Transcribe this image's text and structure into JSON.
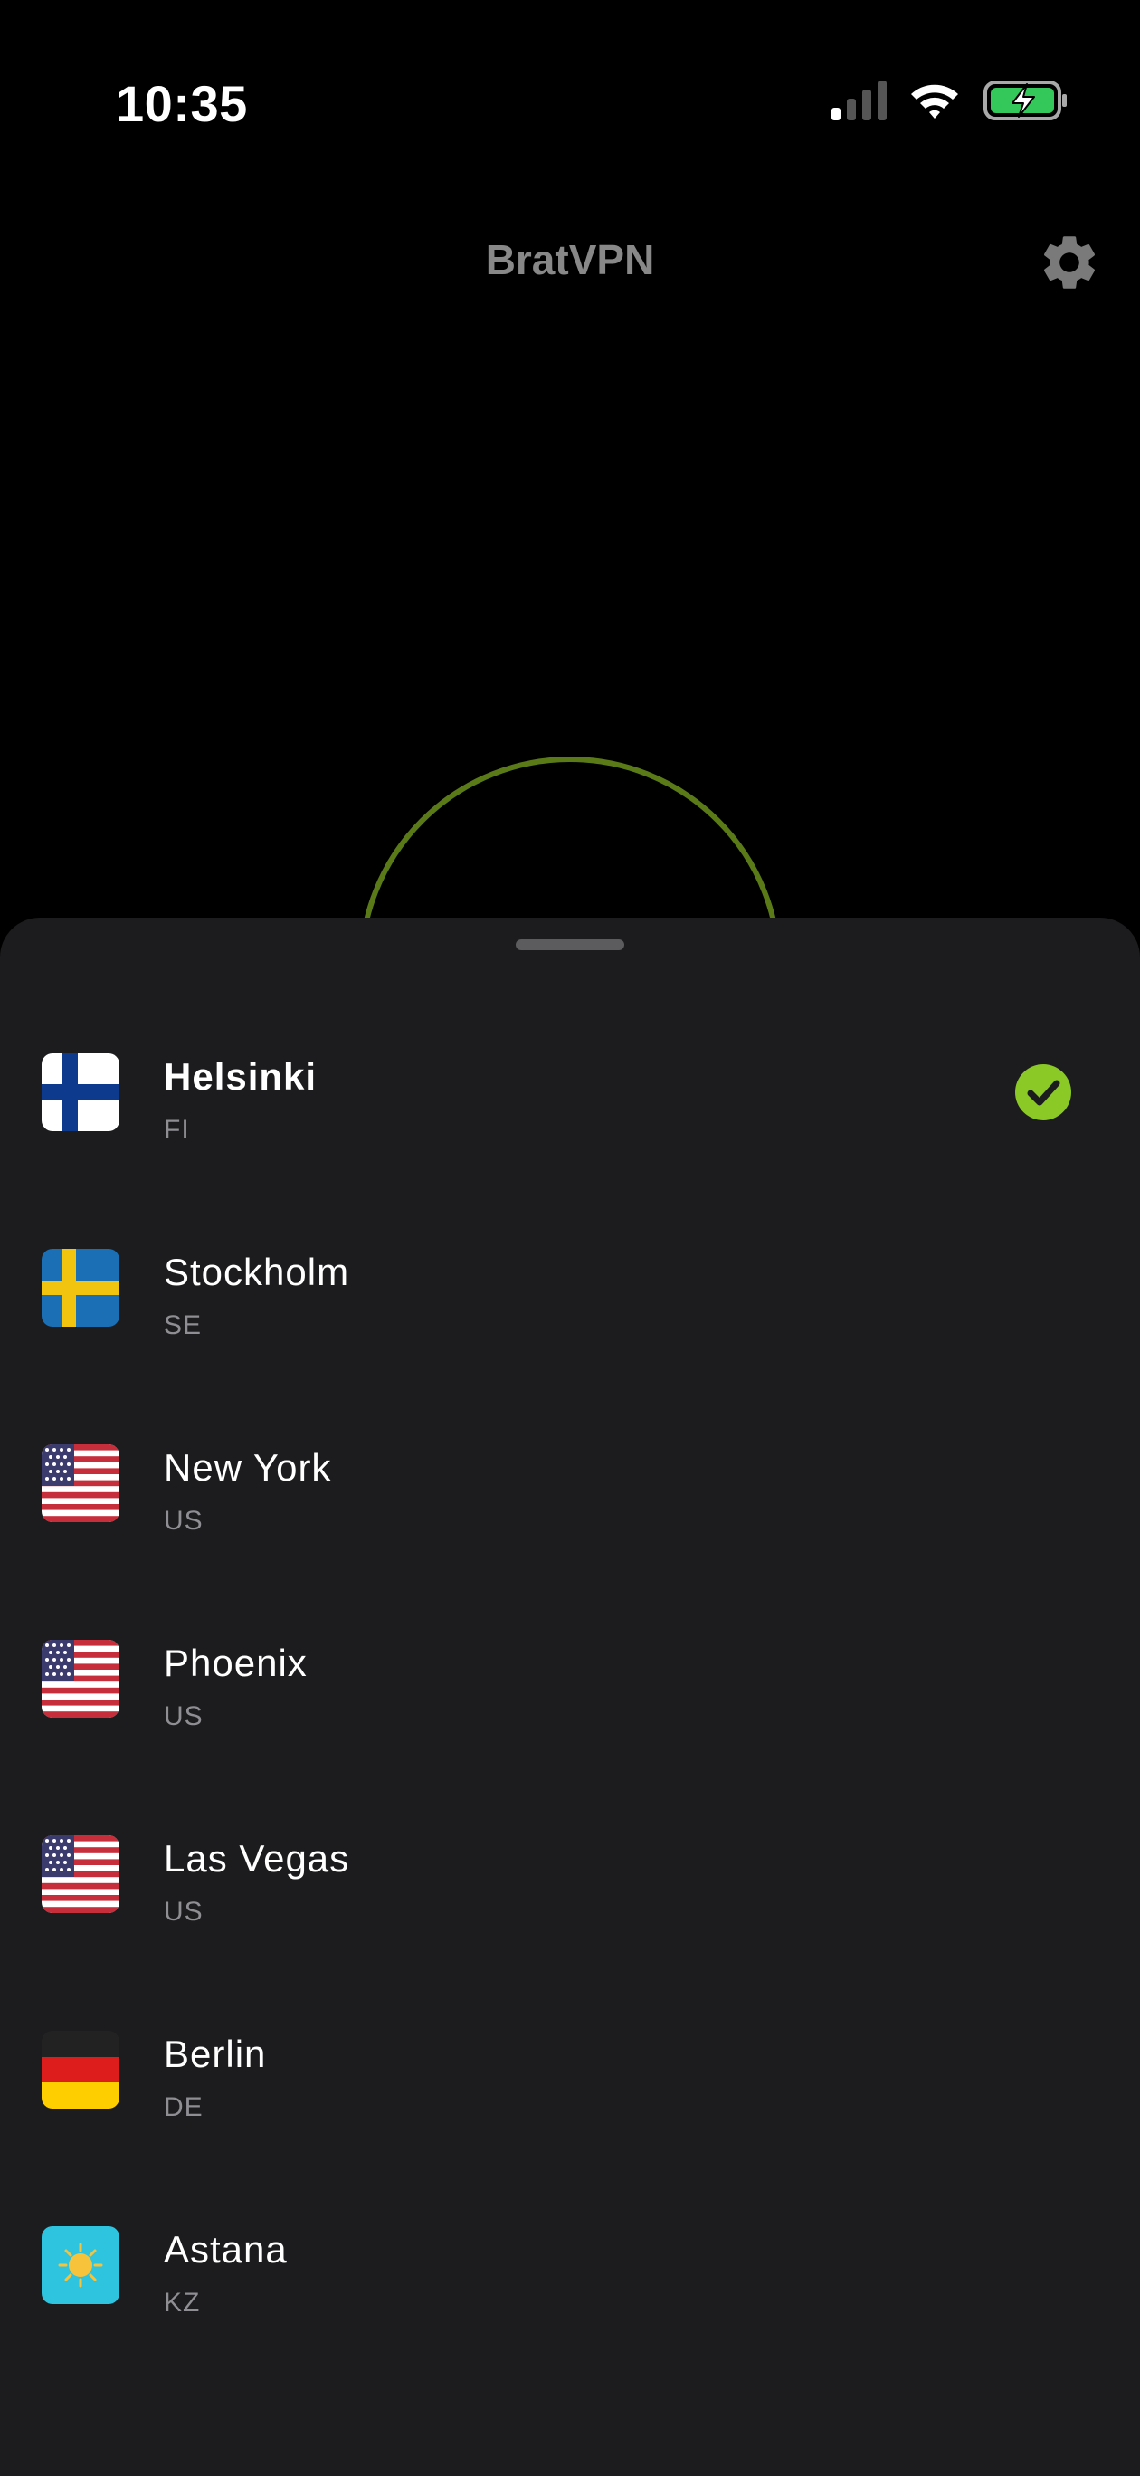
{
  "status_bar": {
    "time": "10:35",
    "signal_icon": "cellular-signal-icon",
    "wifi_icon": "wifi-icon",
    "battery_icon": "battery-charging-icon"
  },
  "header": {
    "title": "BratVPN",
    "settings_icon": "gear-icon"
  },
  "colors": {
    "accent": "#8ac926",
    "ring": "#5a7a18",
    "sheet_bg": "#1c1c1e",
    "secondary_text": "#8e8e93"
  },
  "servers": [
    {
      "city": "Helsinki",
      "code": "FI",
      "flag_icon": "finland-flag-icon",
      "selected": true
    },
    {
      "city": "Stockholm",
      "code": "SE",
      "flag_icon": "sweden-flag-icon",
      "selected": false
    },
    {
      "city": "New York",
      "code": "US",
      "flag_icon": "usa-flag-icon",
      "selected": false
    },
    {
      "city": "Phoenix",
      "code": "US",
      "flag_icon": "usa-flag-icon",
      "selected": false
    },
    {
      "city": "Las Vegas",
      "code": "US",
      "flag_icon": "usa-flag-icon",
      "selected": false
    },
    {
      "city": "Berlin",
      "code": "DE",
      "flag_icon": "germany-flag-icon",
      "selected": false
    },
    {
      "city": "Astana",
      "code": "KZ",
      "flag_icon": "kazakhstan-flag-icon",
      "selected": false
    }
  ]
}
